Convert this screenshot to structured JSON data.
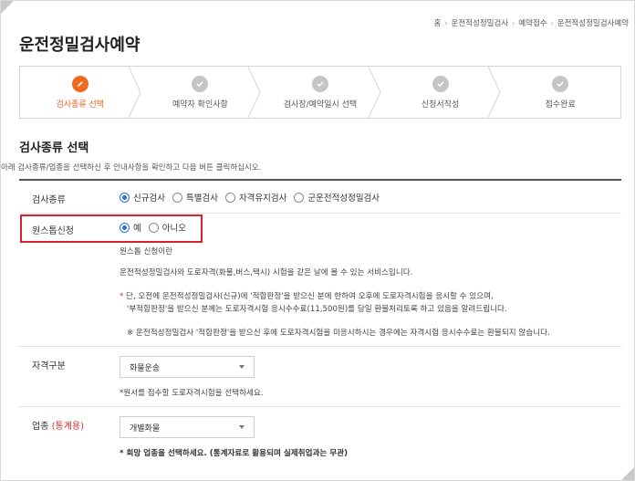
{
  "breadcrumb": [
    "홈",
    "운전적성정밀검사",
    "예약접수",
    "운전적성정밀검사예약"
  ],
  "page_title": "운전정밀검사예약",
  "steps": [
    {
      "label": "검사종류 선택",
      "state": "active",
      "icon": "pencil-icon"
    },
    {
      "label": "예약자 확인사항",
      "state": "pending",
      "icon": "check-icon"
    },
    {
      "label": "검사장/예약일시 선택",
      "state": "pending",
      "icon": "check-icon"
    },
    {
      "label": "신청서작성",
      "state": "pending",
      "icon": "check-icon"
    },
    {
      "label": "접수완료",
      "state": "pending",
      "icon": "check-icon"
    }
  ],
  "section": {
    "title": "검사종류 선택",
    "description": "아래 검사종류/업종을 선택하신 후 안내사항을 확인하고 다음 버튼 클릭하십시오."
  },
  "exam_type": {
    "label": "검사종류",
    "options": [
      "신규검사",
      "특별검사",
      "자격유지검사",
      "군운전적성정밀검사"
    ],
    "selected": "신규검사"
  },
  "onestop": {
    "label": "원스톱신청",
    "options": [
      "예",
      "아니오"
    ],
    "selected": "예",
    "info_title": "원스톱 신청이란",
    "info_desc": "운전적성정밀검사와 도로자격(화물,버스,택시) 시험을 같은 날에 볼 수 있는 서비스입니다.",
    "note_star": "*",
    "note_line1": "단, 오전에 운전적성정밀검사(신규)에 '적합판정'을 받으신 분에 한하여 오후에 도로자격시험을 응시할 수 있으며,",
    "note_line2": "'부적합판정'을 받으신 분께는 도로자격시험 응시수수료(11,500원)를 당일 환불처리토록 하고 있음을 알려드립니다.",
    "note_line3": "※ 운전적성정밀검사 '적합판정'을 받으신 후에 도로자격시험을 미응시하시는 경우에는 자격시험 응시수수료는 환불되지 않습니다."
  },
  "license": {
    "label": "자격구분",
    "selected": "화물운송",
    "help": "*원서를 접수할 도로자격시험을 선택하세요."
  },
  "industry": {
    "label": "업종",
    "label_accent": "(통계용)",
    "selected": "개별화물",
    "help": "* 희망 업종을 선택하세요. (통계자료로 활용되며 실제취업과는 무관)"
  },
  "colors": {
    "accent_orange": "#f06a1c",
    "radio_blue": "#2a6fd6",
    "highlight_red": "#d4232a"
  }
}
